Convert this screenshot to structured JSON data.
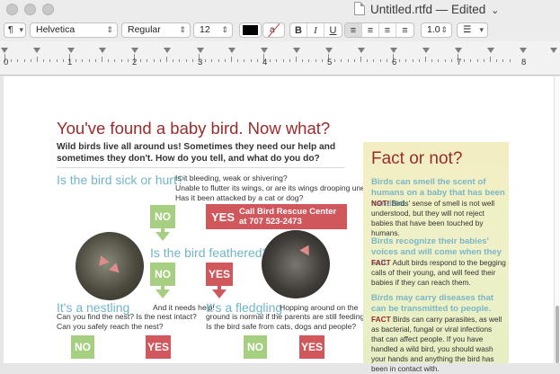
{
  "window": {
    "title": "Untitled.rtfd — Edited",
    "title_chevron": "⌄"
  },
  "toolbar": {
    "paragraph_style": "¶",
    "font_family": "Helvetica",
    "font_style": "Regular",
    "font_size": "12",
    "text_color": "#000000",
    "bold_label": "B",
    "italic_label": "I",
    "underline_label": "U",
    "line_spacing": "1.0",
    "list_label": "☰"
  },
  "ruler": {
    "numbers": [
      "0",
      "1",
      "2",
      "3",
      "4",
      "5",
      "6",
      "7",
      "8"
    ]
  },
  "document": {
    "heading": "You've found a baby bird. Now what?",
    "intro": "Wild birds live all around us! Sometimes they need our help and sometimes they don't. How do you tell, and what do you do?",
    "q1": "Is the bird sick or hurt?",
    "q1_detail": [
      "Is it bleeding, weak or shivering?",
      "Unable to flutter its wings, or are its wings drooping unevenly?",
      "Has it been attacked by a cat or dog?"
    ],
    "no_label": "NO",
    "yes_label": "YES",
    "call_line1": "Call Bird Rescue Center",
    "call_line2": "at 707 523-2473",
    "q2": "Is the bird feathered?",
    "nestling_title": "It's a nestling",
    "nestling_aside": "And it needs help!",
    "nestling_detail": [
      "Can you find the nest? Is the nest intact?",
      "Can you safely reach the nest?"
    ],
    "fledgling_title": "It's a fledgling",
    "fledgling_aside": "Hopping around on the",
    "fledgling_detail": [
      "ground is normal if the parents are still feeding it.",
      "Is the bird safe from cats, dogs and people?"
    ]
  },
  "sidebar": {
    "title": "Fact or not?",
    "items": [
      {
        "question": "Birds can smell the scent of humans on a baby that has been handled.",
        "verdict": "NOT!",
        "answer": "Birds' sense of smell is not well understood, but they will not reject babies that have been touched by humans."
      },
      {
        "question": "Birds recognize their babies' voices and will come when they call.",
        "verdict": "FACT",
        "answer": "Adult birds respond to the begging calls of their young, and will feed their babies if they can reach them."
      },
      {
        "question": "Birds may carry diseases that can be transmitted to people.",
        "verdict": "FACT",
        "answer": "Birds can carry parasites, as well as bacterial, fungal or viral infections that can affect people. If you have handled a wild bird, you should wash your hands and anything the bird has been in contact with."
      }
    ]
  },
  "colors": {
    "heading": "#9b2b2b",
    "question": "#71b5c8",
    "no": "#a7cf82",
    "yes": "#d0585c"
  }
}
